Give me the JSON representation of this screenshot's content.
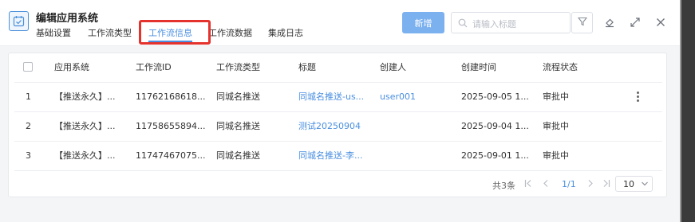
{
  "header": {
    "title": "编辑应用系统",
    "tabs": [
      {
        "label": "基础设置",
        "active": false
      },
      {
        "label": "工作流类型",
        "active": false
      },
      {
        "label": "工作流信息",
        "active": true
      },
      {
        "label": "工作流数据",
        "active": false
      },
      {
        "label": "集成日志",
        "active": false
      }
    ],
    "new_button": "新增",
    "search_placeholder": "请输入标题"
  },
  "table": {
    "columns": [
      "应用系统",
      "工作流ID",
      "工作流类型",
      "标题",
      "创建人",
      "创建时间",
      "流程状态"
    ],
    "rows": [
      {
        "index": "1",
        "app": "【推送永久】...",
        "workflow_id": "11762168618...",
        "type": "同城名推送",
        "title": "同城名推送-us...",
        "creator": "user001",
        "created": "2025-09-05 1...",
        "status": "审批中"
      },
      {
        "index": "2",
        "app": "【推送永久】...",
        "workflow_id": "11758655894...",
        "type": "同城名推送",
        "title": "测试20250904",
        "creator": "",
        "created": "2025-09-04 1...",
        "status": "审批中"
      },
      {
        "index": "3",
        "app": "【推送永久】...",
        "workflow_id": "11747467075...",
        "type": "同城名推送",
        "title": "同城名推送-李...",
        "creator": "",
        "created": "2025-09-01 1...",
        "status": "审批中"
      }
    ]
  },
  "pagination": {
    "total": "共3条",
    "current": "1/1",
    "page_size": "10"
  },
  "colors": {
    "accent": "#4a8fe0",
    "highlight": "#e5322d",
    "new_button": "#7bb1ef"
  }
}
